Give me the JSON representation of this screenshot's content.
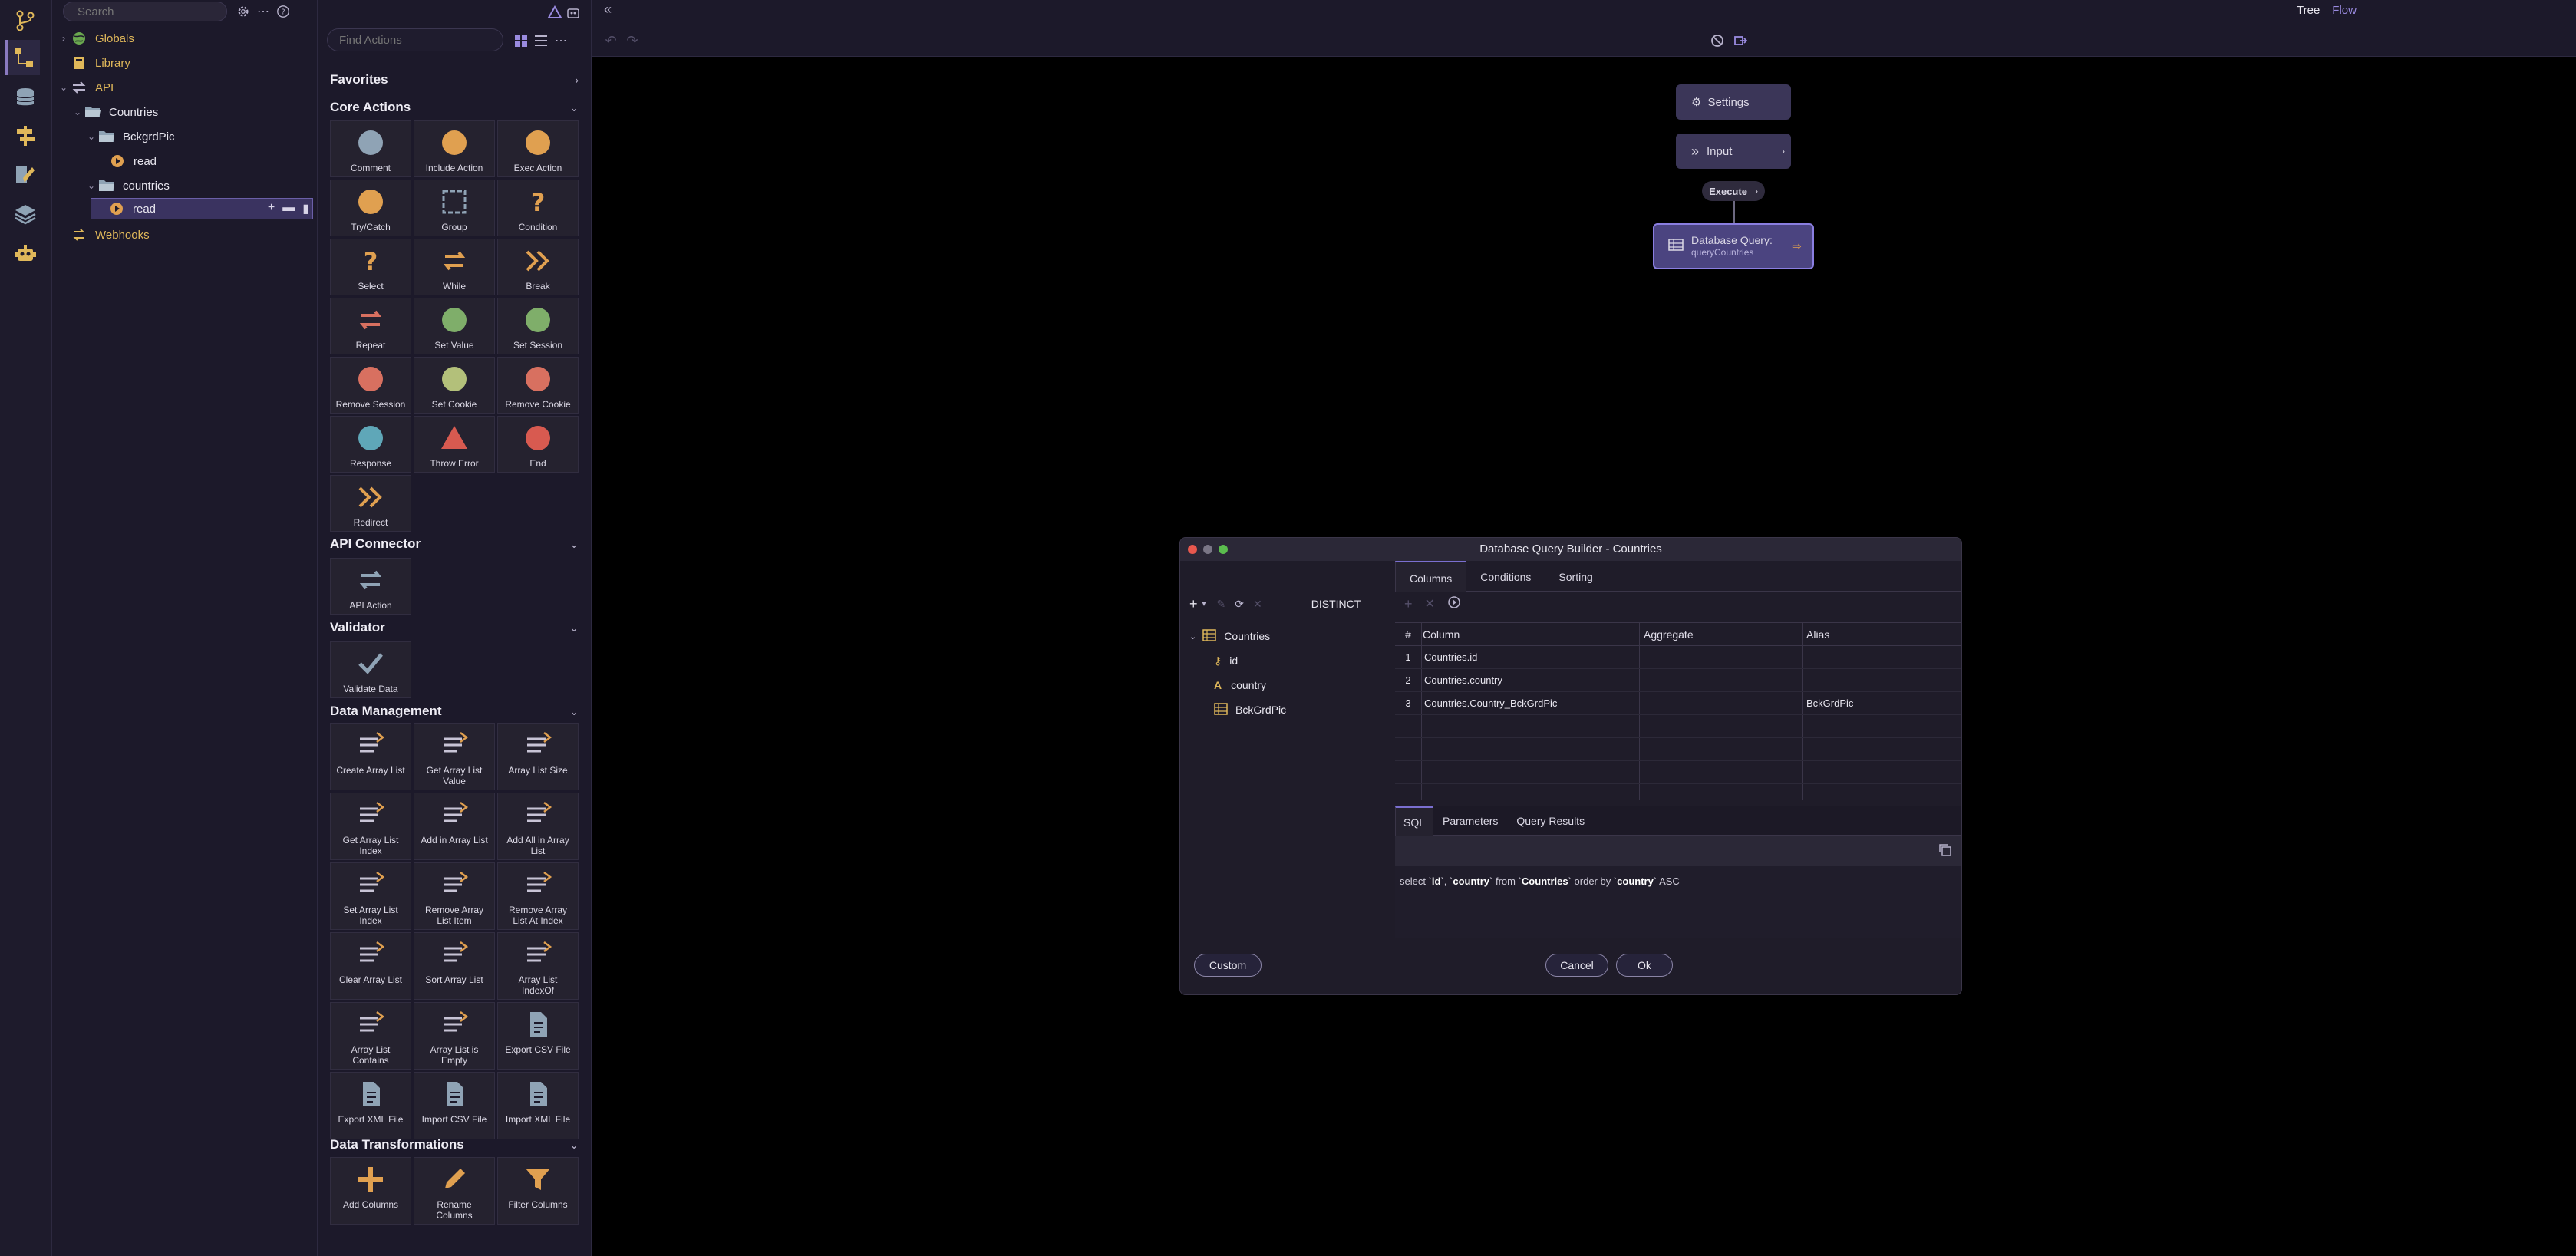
{
  "rail": {
    "items": [
      {
        "icon": "git-branch-icon"
      },
      {
        "icon": "flow-icon",
        "active": true
      },
      {
        "icon": "database-icon"
      },
      {
        "icon": "signpost-icon"
      },
      {
        "icon": "design-icon"
      },
      {
        "icon": "layers-icon"
      },
      {
        "icon": "robot-icon"
      }
    ]
  },
  "tree": {
    "search_placeholder": "Search",
    "nodes": [
      {
        "label": "Globals"
      },
      {
        "label": "Library"
      },
      {
        "label": "API"
      },
      {
        "label": "Countries"
      },
      {
        "label": "BckgrdPic"
      },
      {
        "label": "read"
      },
      {
        "label": "countries"
      },
      {
        "label": "read"
      },
      {
        "label": "Webhooks"
      }
    ]
  },
  "palette": {
    "find_placeholder": "Find Actions",
    "favorites": "Favorites",
    "sections": [
      {
        "title": "Core Actions",
        "items": [
          "Comment",
          "Include Action",
          "Exec Action",
          "Try/Catch",
          "Group",
          "Condition",
          "Select",
          "While",
          "Break",
          "Repeat",
          "Set Value",
          "Set Session",
          "Remove Session",
          "Set Cookie",
          "Remove Cookie",
          "Response",
          "Throw Error",
          "End",
          "Redirect"
        ]
      },
      {
        "title": "API Connector",
        "items": [
          "API Action"
        ]
      },
      {
        "title": "Validator",
        "items": [
          "Validate Data"
        ]
      },
      {
        "title": "Data Management",
        "items": [
          "Create Array List",
          "Get Array List Value",
          "Array List Size",
          "Get Array List Index",
          "Add in Array List",
          "Add All in Array List",
          "Set Array List Index",
          "Remove Array List Item",
          "Remove Array List At Index",
          "Clear Array List",
          "Sort Array List",
          "Array List IndexOf",
          "Array List Contains",
          "Array List is Empty",
          "Export CSV File",
          "Export XML File",
          "Import CSV File",
          "Import XML File"
        ]
      },
      {
        "title": "Data Transformations",
        "items": [
          "Add Columns",
          "Rename Columns",
          "Filter Columns"
        ]
      }
    ]
  },
  "canvas": {
    "view_tree": "Tree",
    "view_flow": "Flow",
    "settings_node": "Settings",
    "input_node": "Input",
    "execute_node": "Execute",
    "db_node_title": "Database Query:",
    "db_node_sub": "queryCountries"
  },
  "dialog": {
    "title": "Database Query Builder - Countries",
    "tabs": [
      "Columns",
      "Conditions",
      "Sorting"
    ],
    "distinct": "DISTINCT",
    "table_tree": {
      "table": "Countries",
      "fields": [
        "id",
        "country",
        "BckGrdPic"
      ]
    },
    "grid_headers": [
      "#",
      "Column",
      "Aggregate",
      "Alias"
    ],
    "rows": [
      {
        "n": "1",
        "column": "Countries.id",
        "aggregate": "",
        "alias": ""
      },
      {
        "n": "2",
        "column": "Countries.country",
        "aggregate": "",
        "alias": ""
      },
      {
        "n": "3",
        "column": "Countries.Country_BckGrdPic",
        "aggregate": "",
        "alias": "BckGrdPic"
      }
    ],
    "bottom_tabs": [
      "SQL",
      "Parameters",
      "Query Results"
    ],
    "sql": {
      "p1": "select `",
      "k1": "id",
      "p2": "`, `",
      "k2": "country",
      "p3": "` from `",
      "k3": "Countries",
      "p4": "` order by `",
      "k4": "country",
      "p5": "` ASC"
    },
    "custom": "Custom",
    "cancel": "Cancel",
    "ok": "Ok"
  },
  "colors": {
    "accent": "#8a7ee0",
    "icon_gold": "#e0b85a",
    "panel": "#1c192a"
  }
}
